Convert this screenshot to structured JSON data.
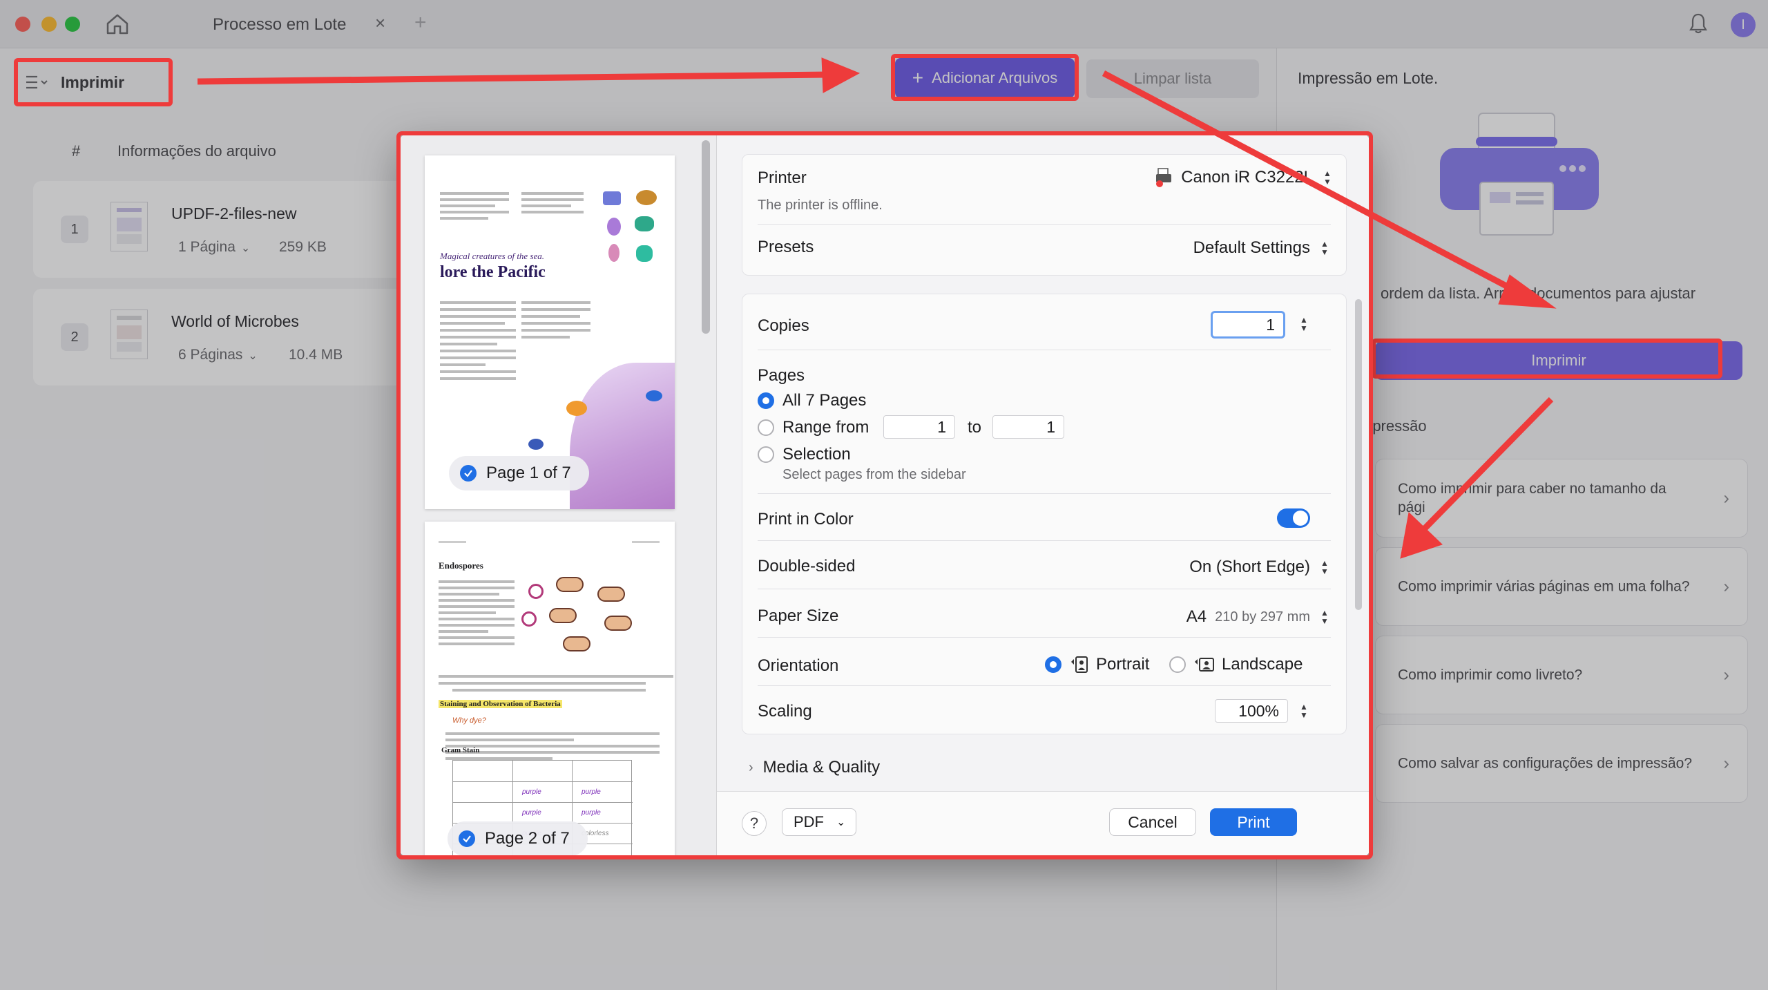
{
  "window": {
    "tab_title": "Processo em Lote",
    "tab_close": "×",
    "tab_add": "+",
    "avatar_initial": "I"
  },
  "toolbar": {
    "menu_label": "Imprimir",
    "add_files_label": "Adicionar Arquivos",
    "clear_list_label": "Limpar lista"
  },
  "file_list": {
    "col_index": "#",
    "col_info": "Informações do arquivo",
    "files": [
      {
        "index": "1",
        "name": "UPDF-2-files-new",
        "pages": "1 Página",
        "size": "259 KB"
      },
      {
        "index": "2",
        "name": "World of Microbes",
        "pages": "6 Páginas",
        "size": "10.4 MB"
      }
    ]
  },
  "right_panel": {
    "title": "Impressão em Lote.",
    "description": "ordem da lista. Arr      os documentos para ajustar",
    "print_button": "Imprimir",
    "section": "mpressão",
    "help_items": [
      "Como imprimir para caber no tamanho da pági",
      "Como imprimir várias páginas em uma folha?",
      "Como imprimir como livreto?",
      "Como salvar as configurações de impressão?"
    ]
  },
  "print_dialog": {
    "thumbnails": [
      {
        "label": "Page 1 of 7",
        "subtitle": "Magical creatures of the sea.",
        "title": "lore the Pacific"
      },
      {
        "label": "Page 2 of 7",
        "heading": "Endospores",
        "section": "Staining and Observation of Bacteria",
        "table_title": "Gram Stain"
      }
    ],
    "printer_label": "Printer",
    "printer_value": "Canon iR C3222L",
    "printer_status": "The printer is offline.",
    "presets_label": "Presets",
    "presets_value": "Default Settings",
    "copies_label": "Copies",
    "copies_value": "1",
    "pages_label": "Pages",
    "pages_all": "All 7 Pages",
    "pages_range": "Range from",
    "range_from": "1",
    "range_to_label": "to",
    "range_to": "1",
    "pages_selection": "Selection",
    "pages_selection_hint": "Select pages from the sidebar",
    "print_color_label": "Print in Color",
    "print_color_on": true,
    "double_sided_label": "Double-sided",
    "double_sided_value": "On (Short Edge)",
    "paper_size_label": "Paper Size",
    "paper_size_value": "A4",
    "paper_size_dims": "210 by 297 mm",
    "orientation_label": "Orientation",
    "orientation_portrait": "Portrait",
    "orientation_landscape": "Landscape",
    "scaling_label": "Scaling",
    "scaling_value": "100%",
    "media_quality_label": "Media & Quality",
    "help_label": "?",
    "pdf_label": "PDF",
    "cancel_label": "Cancel",
    "print_label": "Print"
  },
  "colors": {
    "accent": "#1f6fe5",
    "brand_purple": "#6d5ae8",
    "annotation_red": "#ee3b3b"
  }
}
